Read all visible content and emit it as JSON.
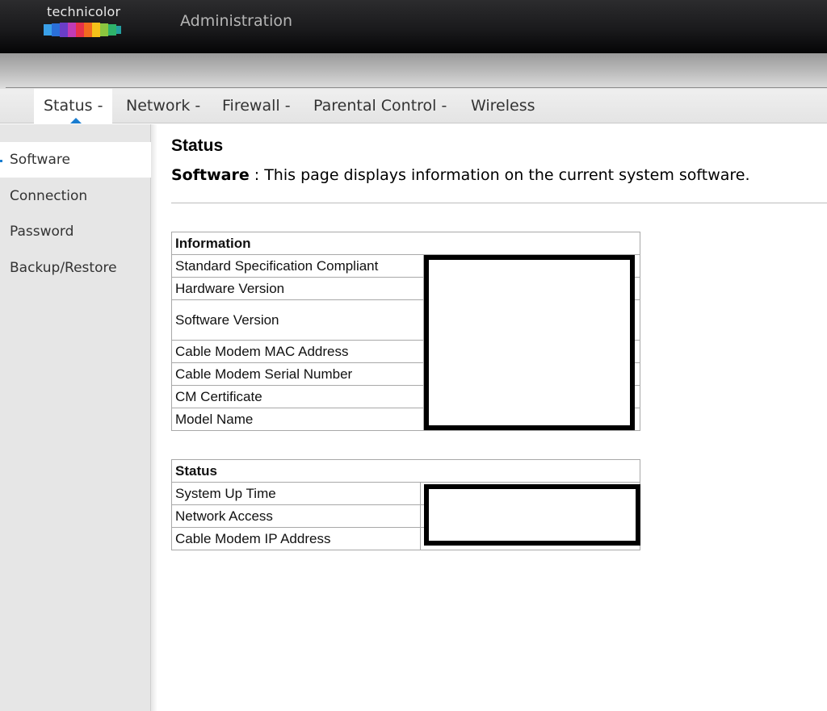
{
  "brand": {
    "logo_text": "technicolor",
    "app_title": "Administration"
  },
  "nav": {
    "tabs": [
      {
        "label": "Status -"
      },
      {
        "label": "Network -"
      },
      {
        "label": "Firewall -"
      },
      {
        "label": "Parental Control -"
      },
      {
        "label": "Wireless"
      }
    ],
    "active_tab": "Status -"
  },
  "sidebar": {
    "items": [
      {
        "label": "Software"
      },
      {
        "label": "Connection"
      },
      {
        "label": "Password"
      },
      {
        "label": "Backup/Restore"
      }
    ],
    "active_item": "Software"
  },
  "main": {
    "title": "Status",
    "description_label": "Software",
    "description_text": " : This page displays information on the current system software."
  },
  "information_table": {
    "header": "Information",
    "rows": [
      {
        "label": "Standard Specification Compliant",
        "value": ""
      },
      {
        "label": "Hardware Version",
        "value": ""
      },
      {
        "label": "Software Version",
        "value": ""
      },
      {
        "label": "Cable Modem MAC Address",
        "value": ""
      },
      {
        "label": "Cable Modem Serial Number",
        "value": ""
      },
      {
        "label": "CM Certificate",
        "value": ""
      },
      {
        "label": "Model Name",
        "value": ""
      }
    ]
  },
  "status_table": {
    "header": "Status",
    "rows": [
      {
        "label": "System Up Time",
        "value": ""
      },
      {
        "label": "Network Access",
        "value": ""
      },
      {
        "label": "Cable Modem IP Address",
        "value": ""
      }
    ]
  },
  "colors": {
    "accent": "#1a7dd0",
    "sidebar_bg": "#e6e6e6",
    "header_bg": "#1a1a1c"
  }
}
